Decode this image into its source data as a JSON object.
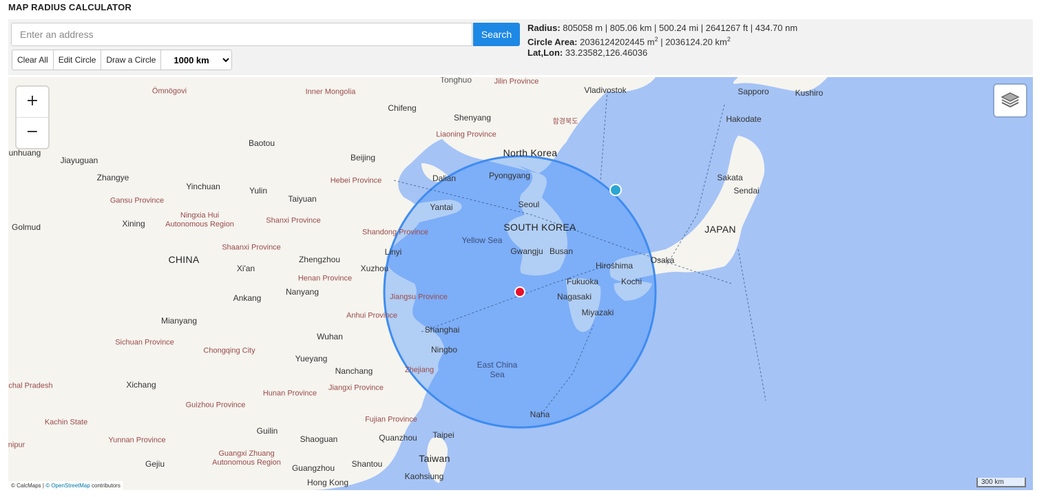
{
  "app": {
    "title": "MAP RADIUS CALCULATOR"
  },
  "search": {
    "placeholder": "Enter an address",
    "value": "",
    "button_label": "Search"
  },
  "toolbar": {
    "clear_label": "Clear All",
    "edit_label": "Edit Circle",
    "draw_label": "Draw a Circle",
    "radius_select": {
      "selected": "1000 km",
      "options": [
        "1000 km"
      ]
    }
  },
  "info": {
    "radius_label": "Radius:",
    "radius_value": "805058 m | 805.06 km | 500.24 mi | 2641267 ft | 434.70 nm",
    "area_label": "Circle Area:",
    "area_m2": "2036124202445 m",
    "area_sep": " | ",
    "area_km2": "2036124.20 km",
    "sup": "2",
    "latlon_label": "Lat,Lon:",
    "latlon_value": "33.23582,126.46036"
  },
  "map": {
    "zoom_in": "+",
    "zoom_out": "−",
    "scale_label": "300 km",
    "attribution_prefix": "© CalcMaps | ",
    "attribution_link": "© OpenStreetMap",
    "attribution_suffix": " contributors",
    "labels": {
      "omnogovi": "Ömnögovi",
      "inner_mongolia": "Inner Mongolia",
      "tonghua": "Tonghuo",
      "jilin": "Jilin Province",
      "vladivostok": "Vladivostok",
      "sapporo": "Sapporo",
      "kushiro": "Kushiro",
      "chifeng": "Chifeng",
      "shenyang": "Shenyang",
      "hamgyong": "함경북도",
      "hakodate": "Hakodate",
      "liaoning": "Liaoning Province",
      "baotou": "Baotou",
      "zhunhuang": "unhuang",
      "jiayuguan": "Jiayuguan",
      "beijing": "Beijing",
      "north_korea": "North Korea",
      "pyongyang": "Pyongyang",
      "zhangye": "Zhangye",
      "yinchuan": "Yinchuan",
      "yulin": "Yulin",
      "hebei": "Hebei Province",
      "dalian": "Dalian",
      "sakata": "Sakata",
      "sendai": "Sendai",
      "gansu": "Gansu Province",
      "taiyuan": "Taiyuan",
      "yantai": "Yantai",
      "seoul": "Seoul",
      "golmud": "Golmud",
      "xining": "Xining",
      "ningxia": "Ningxia Hui Autonomous Region",
      "shanxi": "Shanxi Province",
      "south_korea": "SOUTH KOREA",
      "japan": "JAPAN",
      "shandong": "Shandong Province",
      "yellow_sea": "Yellow Sea",
      "shaanxi": "Shaanxi Province",
      "china": "CHINA",
      "zhengzhou": "Zhengzhou",
      "linyi": "Linyi",
      "gwangju": "Gwangju",
      "busan": "Busan",
      "hiroshima": "Hiroshima",
      "osaka": "Osaka",
      "xian": "Xi'an",
      "xuzhou": "Xuzhou",
      "henan": "Henan Province",
      "fukuoka": "Fukuoka",
      "kochi": "Kochi",
      "ankang": "Ankang",
      "nanyang": "Nanyang",
      "jiangsu": "Jiangsu Province",
      "nagasaki": "Nagasaki",
      "anhui": "Anhui Province",
      "miyazaki": "Miyazaki",
      "mianyang": "Mianyang",
      "shanghai": "Shanghai",
      "wuhan": "Wuhan",
      "sichuan": "Sichuan Province",
      "chongqing": "Chongqing City",
      "ningbo": "Ningbo",
      "yueyang": "Yueyang",
      "east_china_sea": "East China Sea",
      "nanchang": "Nanchang",
      "zhejiang": "Zhejiang",
      "xichang": "Xichang",
      "jiangxi": "Jiangxi Province",
      "hunan": "Hunan Province",
      "arunachal": "ıchal Pradesh",
      "guizhou": "Guizhou Province",
      "naha": "Naha",
      "fujian": "Fujian Province",
      "kachin": "Kachin State",
      "guilin": "Guilin",
      "taipei": "Taipei",
      "yunnan": "Yunnan Province",
      "shaoguan": "Shaoguan",
      "quanzhou": "Quanzhou",
      "manipur": "nipur",
      "guangxi": "Guangxi Zhuang Autonomous Region",
      "taiwan": "Taiwan",
      "gejiu": "Gejiu",
      "guangzhou": "Guangzhou",
      "shantou": "Shantou",
      "kaohsiung": "Kaohsiung",
      "hongkong": "Hong Kong"
    }
  }
}
